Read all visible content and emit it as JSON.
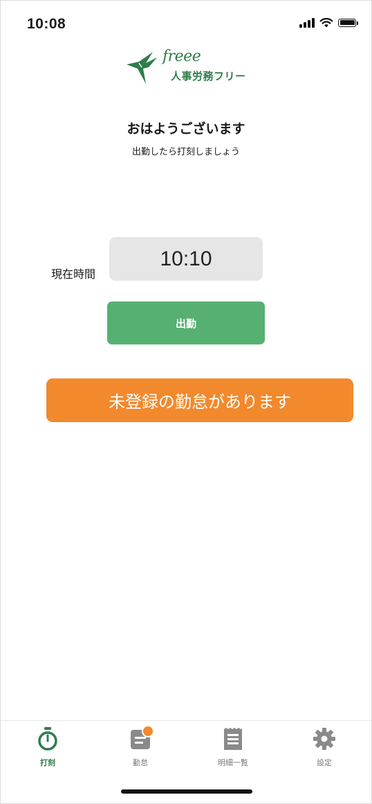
{
  "status_bar": {
    "time": "10:08"
  },
  "logo": {
    "brand": "freee",
    "product": "人事労務フリー",
    "color": "#2e7d4a"
  },
  "greeting": {
    "title": "おはようございます",
    "subtitle": "出勤したら打刻しましょう"
  },
  "clock": {
    "label": "現在時間",
    "current_time": "10:10"
  },
  "actions": {
    "clock_in_label": "出勤",
    "clock_in_color": "#56b071"
  },
  "alert": {
    "message": "未登録の勤怠があります",
    "color": "#f2892d"
  },
  "tab_bar": {
    "tabs": [
      {
        "label": "打刻",
        "icon": "stopwatch-icon",
        "active": true
      },
      {
        "label": "勤怠",
        "icon": "calendar-icon",
        "active": false,
        "has_badge": true
      },
      {
        "label": "明細一覧",
        "icon": "payslip-icon",
        "active": false
      },
      {
        "label": "設定",
        "icon": "gear-icon",
        "active": false
      }
    ]
  }
}
